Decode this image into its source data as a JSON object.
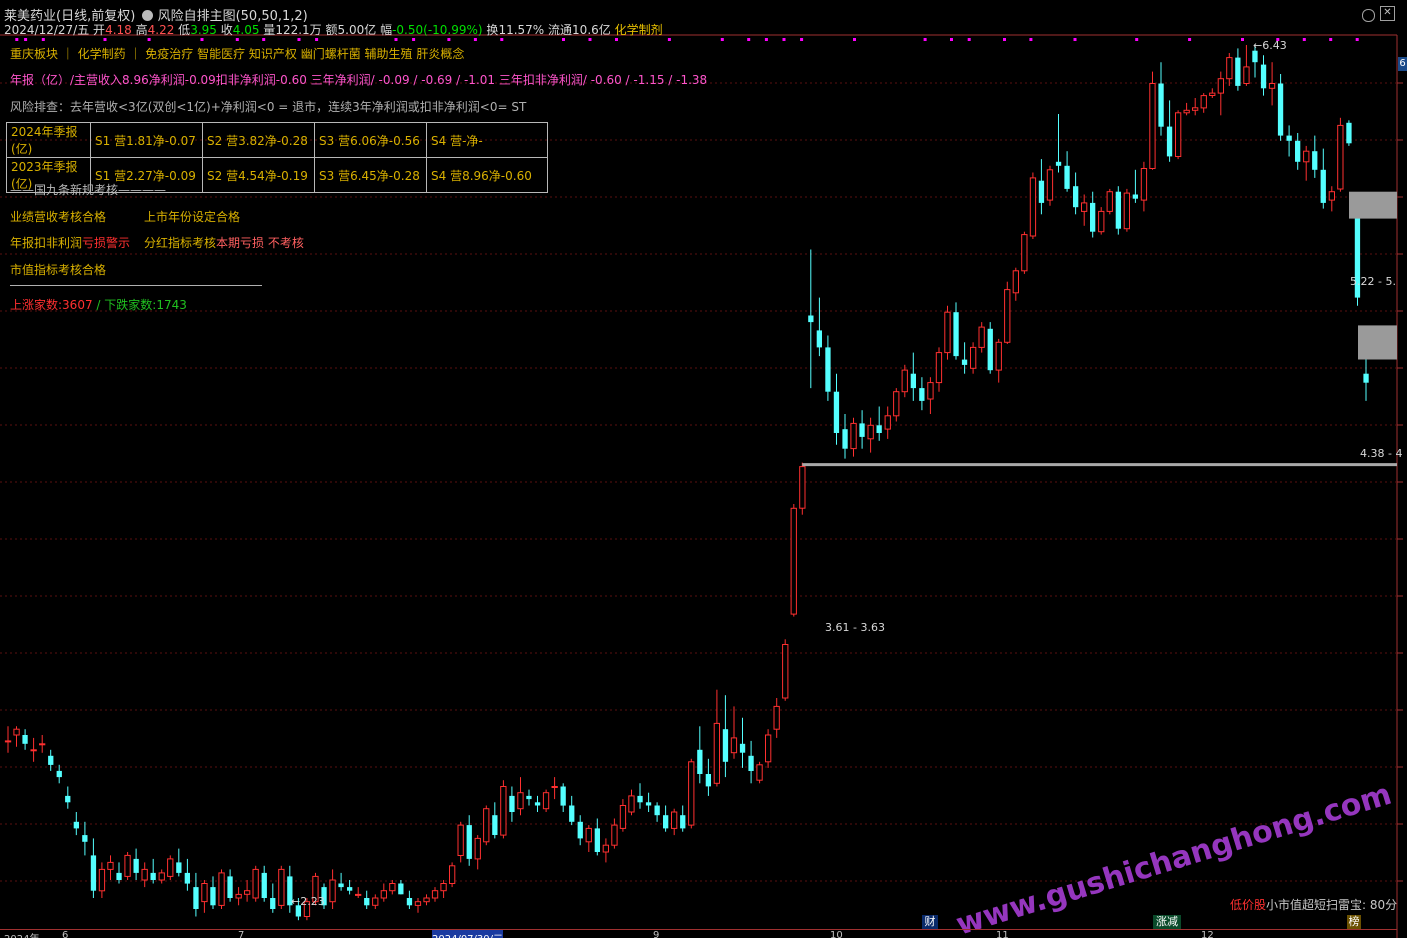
{
  "header": {
    "stock_name": "莱美药业",
    "period": "(日线,前复权)",
    "indicator_name": "风险自排主图(50,50,1,2)",
    "date": "2024/12/27/五",
    "open_label": "开",
    "open": "4.18",
    "high_label": "高",
    "high": "4.22",
    "low_label": "低",
    "low": "3.95",
    "close_label": "收",
    "close": "4.05",
    "volume_label": "量",
    "volume": "122.1万",
    "amount_label": "额",
    "amount": "5.00亿",
    "change_label": "幅",
    "change": "-0.50(-10.99%)",
    "turnover_label": "换",
    "turnover": "11.57%",
    "float_label": "流通",
    "float": "10.6亿",
    "industry": "化学制剂"
  },
  "concepts": "重庆板块 ｜ 化学制药 ｜ 免疫治疗 智能医疗 知识产权 幽门螺杆菌 辅助生殖 肝炎概念",
  "annual_report": "年报（亿）/主营收入8.96净利润-0.09扣非净利润-0.60  三年净利润/ -0.09 / -0.69 / -1.01  三年扣非净利润/ -0.60 / -1.15 / -1.38",
  "risk_check": "风险排查：去年营收<3亿(双创<1亿)+净利润<0 = 退市，连续3年净利润或扣非净利润<0= ST",
  "quarterly": [
    [
      "2024年季报(亿)",
      "S1 营1.81净-0.07",
      "S2 营3.82净-0.28",
      "S3 营6.06净-0.56",
      "S4 营-净-"
    ],
    [
      "2023年季报(亿)",
      "S1 营2.27净-0.09",
      "S2 营4.54净-0.19",
      "S3 营6.45净-0.28",
      "S4 营8.96净-0.60"
    ]
  ],
  "rules": {
    "title": "——国九条新规考核————",
    "revenue_check": "业绩营收考核合格",
    "listing_check": "上市年份设定合格",
    "profit_label": "年报扣非利润",
    "profit_status": "亏损警示",
    "dividend_label": "分红指标考核",
    "dividend_status": "本期亏损 不考核",
    "marketcap_check": "市值指标考核合格"
  },
  "market_stats": {
    "up": "上涨家数:3607",
    "down": "/ 下跌家数:1743"
  },
  "chart_labels": {
    "high_mark": "←6.43",
    "low_mark": "←2.23",
    "zone1": "5.22 - 5.",
    "zone2": "4.38 - 4",
    "zone3": "3.61 - 3.63",
    "right_price": "6"
  },
  "bottom_bar": {
    "tag_cai": "财",
    "tag_zhangjian": "涨减",
    "tag_bang": "榜",
    "scanner_red": "低价股",
    "scanner_text": "小市值超短扫雷宝: 80分",
    "dates": [
      "2024年",
      "6",
      "7",
      "2024/07/30/二",
      "9",
      "10",
      "11",
      "12"
    ]
  },
  "watermark": "www.gushichanghong.com",
  "colors": {
    "up": "#ff3030",
    "down": "#54ffff",
    "magenta": "#ff00ff",
    "bg": "#000000"
  },
  "chart_data": {
    "type": "candlestick",
    "ohlc": [
      [
        2.48,
        2.53,
        2.44,
        2.48
      ],
      [
        2.5,
        2.53,
        2.46,
        2.52
      ],
      [
        2.5,
        2.52,
        2.45,
        2.47
      ],
      [
        2.45,
        2.49,
        2.41,
        2.45
      ],
      [
        2.47,
        2.5,
        2.44,
        2.47
      ],
      [
        2.43,
        2.45,
        2.38,
        2.4
      ],
      [
        2.38,
        2.4,
        2.34,
        2.36
      ],
      [
        2.3,
        2.33,
        2.26,
        2.28
      ],
      [
        2.22,
        2.25,
        2.18,
        2.2
      ],
      [
        2.18,
        2.22,
        2.12,
        2.16
      ],
      [
        2.12,
        2.17,
        2.0,
        2.02
      ],
      [
        2.02,
        2.1,
        2.0,
        2.08
      ],
      [
        2.08,
        2.12,
        2.05,
        2.1
      ],
      [
        2.07,
        2.1,
        2.04,
        2.05
      ],
      [
        2.06,
        2.13,
        2.05,
        2.12
      ],
      [
        2.11,
        2.14,
        2.05,
        2.07
      ],
      [
        2.05,
        2.1,
        2.03,
        2.08
      ],
      [
        2.07,
        2.11,
        2.04,
        2.05
      ],
      [
        2.05,
        2.08,
        2.04,
        2.07
      ],
      [
        2.06,
        2.12,
        2.05,
        2.11
      ],
      [
        2.1,
        2.14,
        2.06,
        2.07
      ],
      [
        2.07,
        2.11,
        2.02,
        2.04
      ],
      [
        2.03,
        2.07,
        1.95,
        1.97
      ],
      [
        1.99,
        2.05,
        1.96,
        2.04
      ],
      [
        2.03,
        2.06,
        1.97,
        1.98
      ],
      [
        1.98,
        2.08,
        1.97,
        2.07
      ],
      [
        2.06,
        2.08,
        1.99,
        2.0
      ],
      [
        2.0,
        2.03,
        1.98,
        2.01
      ],
      [
        2.01,
        2.05,
        1.99,
        2.02
      ],
      [
        2.0,
        2.09,
        1.99,
        2.08
      ],
      [
        2.07,
        2.09,
        1.99,
        2.0
      ],
      [
        2.0,
        2.04,
        1.96,
        1.97
      ],
      [
        1.98,
        2.09,
        1.97,
        2.08
      ],
      [
        2.06,
        2.09,
        1.96,
        1.98
      ],
      [
        1.98,
        2.0,
        1.94,
        1.95
      ],
      [
        1.95,
        2.0,
        1.94,
        1.99
      ],
      [
        1.99,
        2.07,
        1.98,
        2.06
      ],
      [
        2.03,
        2.04,
        1.97,
        1.98
      ],
      [
        1.99,
        2.08,
        1.97,
        2.05
      ],
      [
        2.04,
        2.07,
        2.02,
        2.03
      ],
      [
        2.03,
        2.05,
        2.01,
        2.02
      ],
      [
        2.01,
        2.03,
        2.0,
        2.01
      ],
      [
        2.0,
        2.02,
        1.97,
        1.98
      ],
      [
        1.98,
        2.01,
        1.97,
        2.0
      ],
      [
        2.0,
        2.04,
        1.99,
        2.02
      ],
      [
        2.02,
        2.05,
        2.01,
        2.04
      ],
      [
        2.04,
        2.05,
        2.01,
        2.01
      ],
      [
        2.0,
        2.02,
        1.97,
        1.98
      ],
      [
        1.98,
        2.0,
        1.96,
        1.99
      ],
      [
        1.99,
        2.01,
        1.98,
        2.0
      ],
      [
        2.0,
        2.03,
        1.99,
        2.02
      ],
      [
        2.02,
        2.05,
        2.0,
        2.04
      ],
      [
        2.04,
        2.1,
        2.03,
        2.09
      ],
      [
        2.12,
        2.22,
        2.1,
        2.21
      ],
      [
        2.21,
        2.24,
        2.09,
        2.11
      ],
      [
        2.11,
        2.18,
        2.08,
        2.17
      ],
      [
        2.16,
        2.27,
        2.15,
        2.26
      ],
      [
        2.24,
        2.28,
        2.17,
        2.18
      ],
      [
        2.18,
        2.35,
        2.17,
        2.33
      ],
      [
        2.3,
        2.33,
        2.22,
        2.25
      ],
      [
        2.26,
        2.36,
        2.24,
        2.31
      ],
      [
        2.3,
        2.32,
        2.27,
        2.29
      ],
      [
        2.28,
        2.3,
        2.25,
        2.27
      ],
      [
        2.26,
        2.32,
        2.25,
        2.31
      ],
      [
        2.33,
        2.36,
        2.29,
        2.33
      ],
      [
        2.33,
        2.34,
        2.25,
        2.27
      ],
      [
        2.27,
        2.3,
        2.21,
        2.22
      ],
      [
        2.22,
        2.24,
        2.15,
        2.17
      ],
      [
        2.16,
        2.21,
        2.13,
        2.2
      ],
      [
        2.2,
        2.23,
        2.12,
        2.13
      ],
      [
        2.13,
        2.17,
        2.1,
        2.15
      ],
      [
        2.15,
        2.23,
        2.14,
        2.21
      ],
      [
        2.2,
        2.29,
        2.19,
        2.27
      ],
      [
        2.25,
        2.32,
        2.24,
        2.3
      ],
      [
        2.3,
        2.34,
        2.26,
        2.28
      ],
      [
        2.28,
        2.31,
        2.25,
        2.27
      ],
      [
        2.27,
        2.28,
        2.22,
        2.24
      ],
      [
        2.24,
        2.27,
        2.19,
        2.2
      ],
      [
        2.2,
        2.26,
        2.18,
        2.25
      ],
      [
        2.24,
        2.27,
        2.19,
        2.2
      ],
      [
        2.21,
        2.42,
        2.2,
        2.41
      ],
      [
        2.45,
        2.53,
        2.34,
        2.37
      ],
      [
        2.37,
        2.42,
        2.3,
        2.33
      ],
      [
        2.34,
        2.66,
        2.33,
        2.54
      ],
      [
        2.52,
        2.64,
        2.36,
        2.41
      ],
      [
        2.44,
        2.6,
        2.42,
        2.49
      ],
      [
        2.47,
        2.56,
        2.39,
        2.44
      ],
      [
        2.43,
        2.48,
        2.34,
        2.38
      ],
      [
        2.35,
        2.41,
        2.34,
        2.4
      ],
      [
        2.41,
        2.52,
        2.39,
        2.5
      ],
      [
        2.52,
        2.63,
        2.49,
        2.6
      ],
      [
        2.63,
        2.85,
        2.62,
        2.83
      ],
      [
        2.95,
        3.43,
        2.94,
        3.41
      ],
      [
        3.41,
        3.63,
        3.38,
        3.61
      ],
      [
        4.44,
        4.86,
        4.02,
        4.4
      ],
      [
        4.35,
        4.55,
        4.2,
        4.25
      ],
      [
        4.25,
        4.32,
        3.95,
        4.0
      ],
      [
        4.0,
        4.1,
        3.72,
        3.78
      ],
      [
        3.8,
        3.88,
        3.65,
        3.7
      ],
      [
        3.7,
        3.86,
        3.66,
        3.83
      ],
      [
        3.83,
        3.9,
        3.7,
        3.76
      ],
      [
        3.75,
        3.86,
        3.68,
        3.82
      ],
      [
        3.82,
        3.92,
        3.74,
        3.78
      ],
      [
        3.8,
        3.92,
        3.75,
        3.87
      ],
      [
        3.87,
        4.02,
        3.84,
        4.0
      ],
      [
        4.0,
        4.15,
        3.97,
        4.12
      ],
      [
        4.1,
        4.22,
        3.95,
        4.02
      ],
      [
        4.02,
        4.08,
        3.9,
        3.95
      ],
      [
        3.96,
        4.08,
        3.88,
        4.05
      ],
      [
        4.05,
        4.25,
        4.0,
        4.22
      ],
      [
        4.22,
        4.5,
        4.18,
        4.46
      ],
      [
        4.46,
        4.52,
        4.18,
        4.2
      ],
      [
        4.18,
        4.28,
        4.1,
        4.15
      ],
      [
        4.13,
        4.28,
        4.1,
        4.25
      ],
      [
        4.25,
        4.4,
        4.22,
        4.37
      ],
      [
        4.36,
        4.4,
        4.1,
        4.12
      ],
      [
        4.12,
        4.3,
        4.05,
        4.28
      ],
      [
        4.28,
        4.65,
        4.27,
        4.6
      ],
      [
        4.58,
        4.74,
        4.53,
        4.72
      ],
      [
        4.72,
        4.98,
        4.7,
        4.96
      ],
      [
        4.95,
        5.4,
        4.93,
        5.36
      ],
      [
        5.34,
        5.5,
        5.1,
        5.18
      ],
      [
        5.2,
        5.45,
        5.16,
        5.42
      ],
      [
        5.48,
        5.85,
        5.4,
        5.45
      ],
      [
        5.45,
        5.56,
        5.26,
        5.28
      ],
      [
        5.3,
        5.4,
        5.1,
        5.15
      ],
      [
        5.12,
        5.24,
        5.02,
        5.18
      ],
      [
        5.18,
        5.26,
        4.94,
        4.98
      ],
      [
        4.98,
        5.15,
        4.96,
        5.12
      ],
      [
        5.12,
        5.28,
        5.1,
        5.26
      ],
      [
        5.26,
        5.3,
        4.96,
        5.0
      ],
      [
        5.0,
        5.28,
        4.98,
        5.25
      ],
      [
        5.24,
        5.42,
        5.18,
        5.21
      ],
      [
        5.2,
        5.48,
        5.12,
        5.43
      ],
      [
        5.43,
        6.2,
        5.42,
        6.1
      ],
      [
        6.1,
        6.28,
        5.68,
        5.75
      ],
      [
        5.75,
        5.96,
        5.48,
        5.52
      ],
      [
        5.52,
        5.88,
        5.5,
        5.86
      ],
      [
        5.86,
        5.94,
        5.84,
        5.88
      ],
      [
        5.88,
        5.98,
        5.84,
        5.9
      ],
      [
        5.9,
        6.02,
        5.86,
        6.0
      ],
      [
        6.0,
        6.06,
        5.98,
        6.02
      ],
      [
        6.02,
        6.2,
        5.84,
        6.14
      ],
      [
        6.14,
        6.36,
        6.08,
        6.32
      ],
      [
        6.32,
        6.4,
        6.04,
        6.08
      ],
      [
        6.1,
        6.43,
        6.08,
        6.24
      ],
      [
        6.38,
        6.43,
        6.15,
        6.28
      ],
      [
        6.26,
        6.34,
        6.0,
        6.06
      ],
      [
        6.06,
        6.28,
        5.92,
        6.1
      ],
      [
        6.1,
        6.18,
        5.64,
        5.68
      ],
      [
        5.68,
        5.76,
        5.52,
        5.64
      ],
      [
        5.64,
        5.7,
        5.42,
        5.48
      ],
      [
        5.48,
        5.6,
        5.34,
        5.56
      ],
      [
        5.56,
        5.68,
        5.36,
        5.42
      ],
      [
        5.42,
        5.58,
        5.14,
        5.18
      ],
      [
        5.2,
        5.3,
        5.12,
        5.26
      ],
      [
        5.28,
        5.82,
        5.26,
        5.76
      ],
      [
        5.78,
        5.8,
        5.6,
        5.62
      ],
      [
        5.2,
        5.25,
        4.5,
        4.55
      ],
      [
        4.1,
        4.22,
        3.95,
        4.05
      ]
    ]
  }
}
